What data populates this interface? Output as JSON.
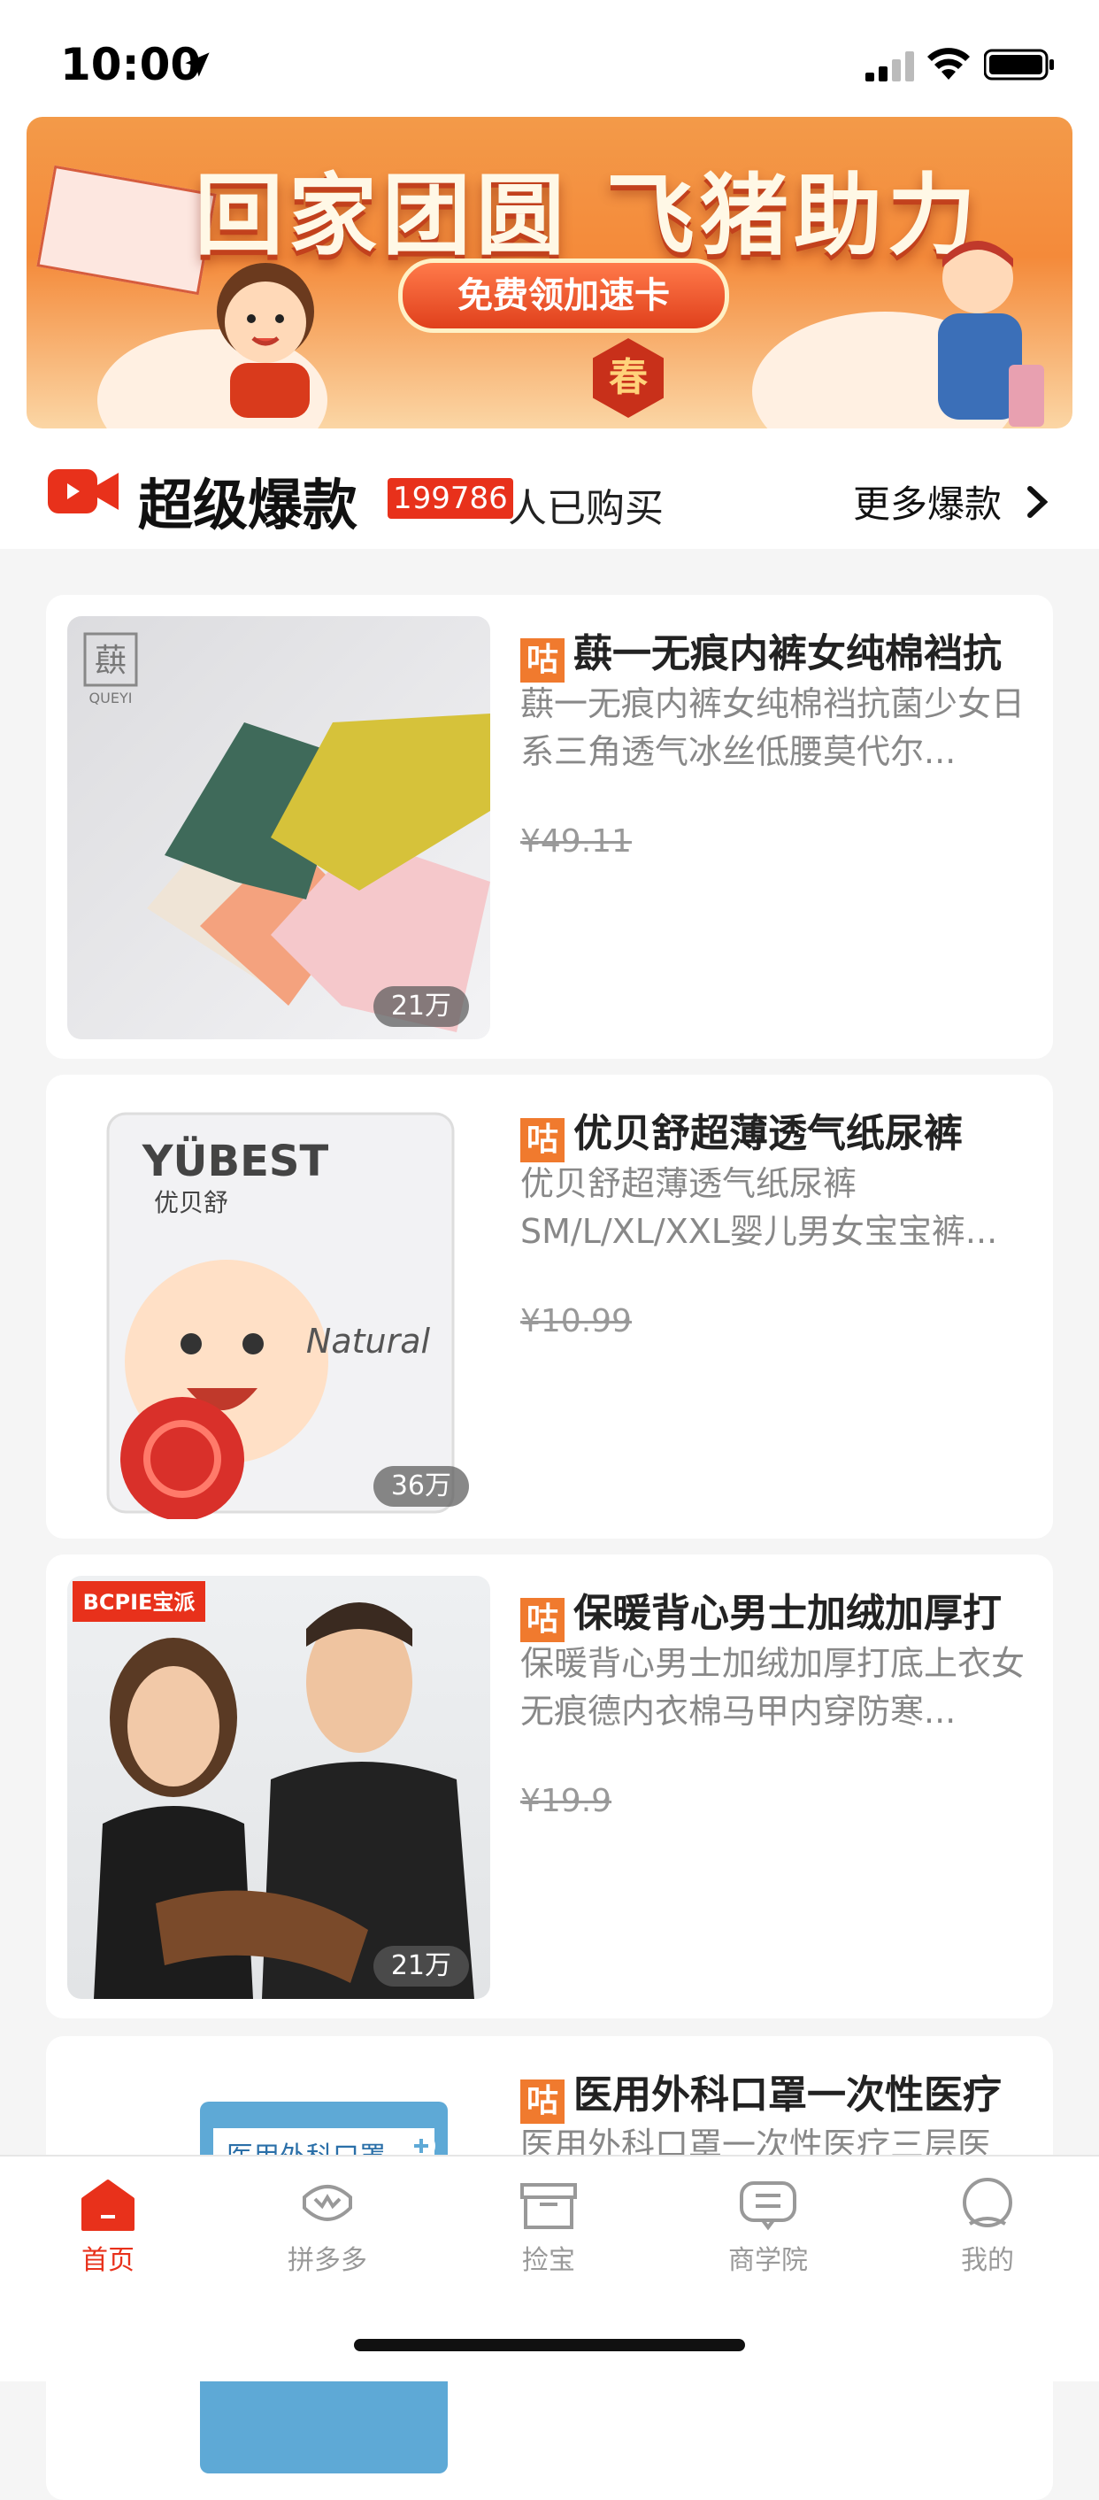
{
  "status_bar": {
    "time": "10:00"
  },
  "banner": {
    "title": "回家团圆 飞猪助力",
    "button_label": "免费领加速卡",
    "stamp_text": "春",
    "slide_count": 3,
    "active_slide": 3
  },
  "hot_section": {
    "title": "超级爆款",
    "buyer_count": "199786",
    "buyers_suffix": "人已购买",
    "more_label": "更多爆款"
  },
  "products": [
    {
      "tag": "咕",
      "title": "蕻一无痕内裤女纯棉裆抗",
      "desc": "蕻一无痕内裤女纯棉裆抗菌少女日系三角透气冰丝低腰莫代尔...",
      "price": "¥49.11",
      "sales": "21万"
    },
    {
      "tag": "咕",
      "title": "优贝舒超薄透气纸尿裤",
      "desc": "优贝舒超薄透气纸尿裤SM/L/XL/XXL婴儿男女宝宝裤...",
      "price": "¥10.99",
      "sales": "36万"
    },
    {
      "tag": "咕",
      "title": "保暖背心男士加绒加厚打",
      "desc": "保暖背心男士加绒加厚打底上衣女无痕德内衣棉马甲内穿防寒...",
      "price": "¥19.9",
      "sales": "21万"
    },
    {
      "tag": "咕",
      "title": "医用外科口罩一次性医疗",
      "desc": "医用外科口罩一次性医疗三层医",
      "price": "",
      "sales": ""
    }
  ],
  "thumb_text": {
    "brand1": "QUEYI",
    "brand2": "YÜBEST",
    "brand2_cn": "优贝舒",
    "brand2_sub": "Natural",
    "brand3": "BCPIE宝派",
    "mask_pack": "医用外科口罩"
  },
  "tabbar": {
    "tabs": [
      {
        "label": "首页",
        "icon": "home-icon",
        "active": true
      },
      {
        "label": "拼多多",
        "icon": "pinduoduo-icon",
        "active": false
      },
      {
        "label": "捡宝",
        "icon": "box-icon",
        "active": false
      },
      {
        "label": "商学院",
        "icon": "chat-icon",
        "active": false
      },
      {
        "label": "我的",
        "icon": "user-icon",
        "active": false
      }
    ]
  },
  "colors": {
    "accent": "#e8311b",
    "tag": "#f07a2e",
    "background": "#f5f5f5"
  }
}
